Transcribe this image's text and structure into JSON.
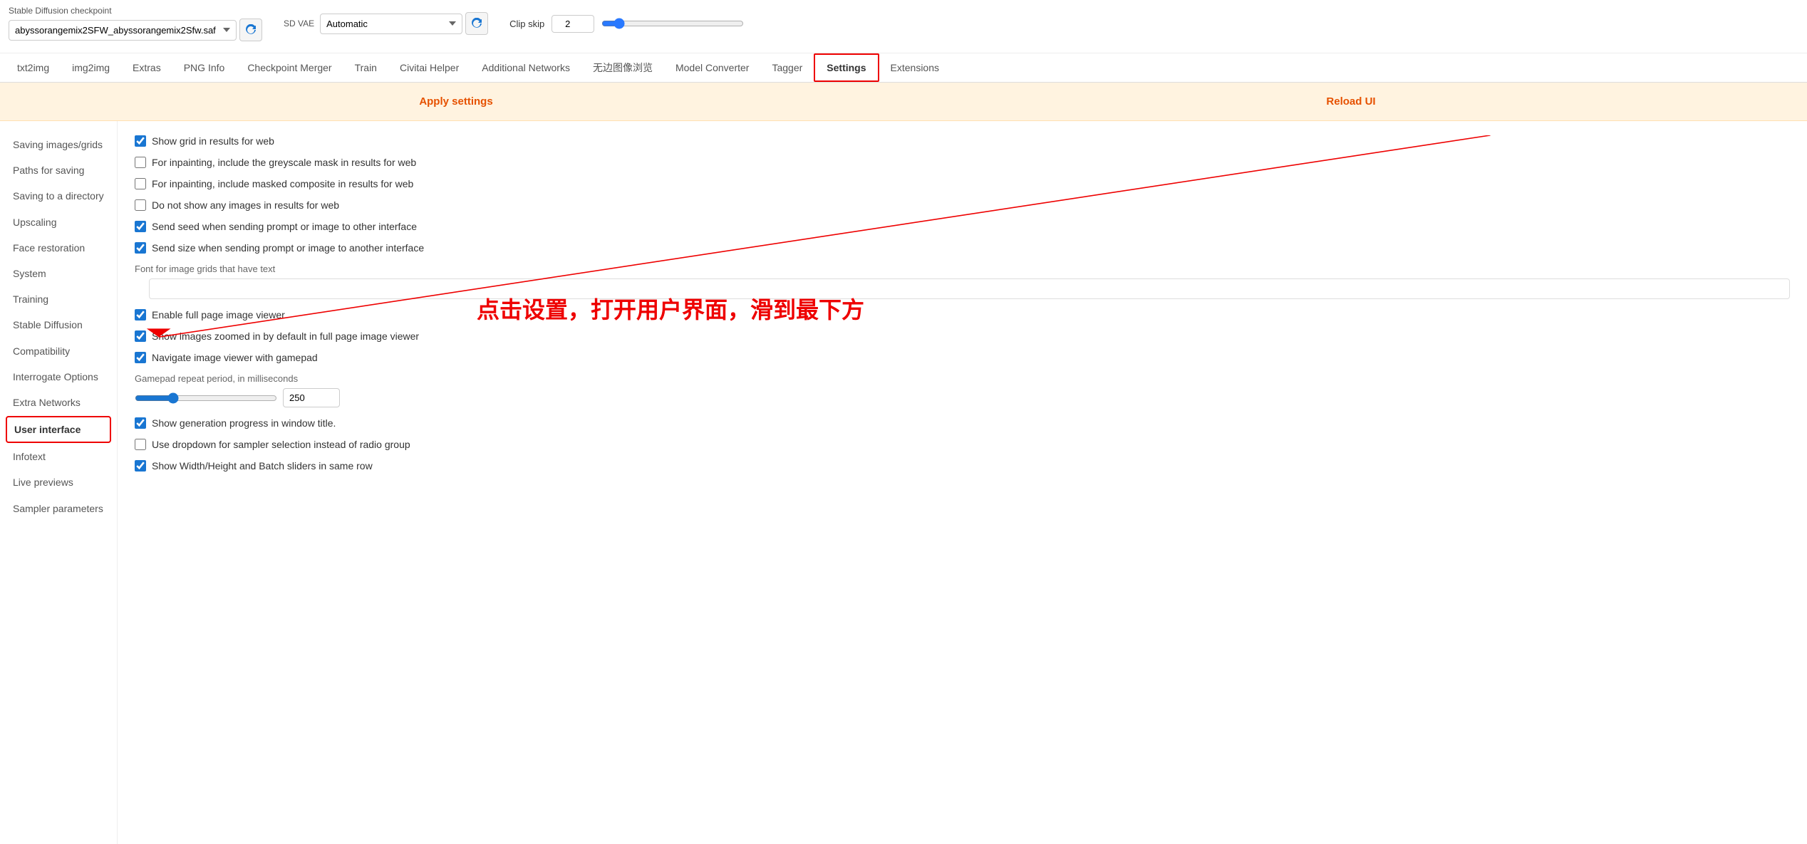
{
  "header": {
    "checkpoint_label": "Stable Diffusion checkpoint",
    "checkpoint_value": "abyssorangemix2SFW_abyssorangemix2Sfw.saf",
    "vae_label": "SD VAE",
    "vae_value": "Automatic",
    "clip_label": "Clip skip",
    "clip_value": "2"
  },
  "nav": {
    "tabs": [
      {
        "id": "txt2img",
        "label": "txt2img"
      },
      {
        "id": "img2img",
        "label": "img2img"
      },
      {
        "id": "extras",
        "label": "Extras"
      },
      {
        "id": "png-info",
        "label": "PNG Info"
      },
      {
        "id": "checkpoint-merger",
        "label": "Checkpoint Merger"
      },
      {
        "id": "train",
        "label": "Train"
      },
      {
        "id": "civitai-helper",
        "label": "Civitai Helper"
      },
      {
        "id": "additional-networks",
        "label": "Additional Networks"
      },
      {
        "id": "wubian",
        "label": "无边图像浏览"
      },
      {
        "id": "model-converter",
        "label": "Model Converter"
      },
      {
        "id": "tagger",
        "label": "Tagger"
      },
      {
        "id": "settings",
        "label": "Settings"
      },
      {
        "id": "extensions",
        "label": "Extensions"
      }
    ],
    "active": "settings"
  },
  "actions": {
    "apply_label": "Apply settings",
    "reload_label": "Reload UI"
  },
  "sidebar": {
    "items": [
      {
        "id": "saving-images",
        "label": "Saving images/grids"
      },
      {
        "id": "paths-for-saving",
        "label": "Paths for saving"
      },
      {
        "id": "saving-to-directory",
        "label": "Saving to a directory"
      },
      {
        "id": "upscaling",
        "label": "Upscaling"
      },
      {
        "id": "face-restoration",
        "label": "Face restoration"
      },
      {
        "id": "system",
        "label": "System"
      },
      {
        "id": "training",
        "label": "Training"
      },
      {
        "id": "stable-diffusion",
        "label": "Stable Diffusion"
      },
      {
        "id": "compatibility",
        "label": "Compatibility"
      },
      {
        "id": "interrogate-options",
        "label": "Interrogate Options"
      },
      {
        "id": "extra-networks",
        "label": "Extra Networks"
      },
      {
        "id": "user-interface",
        "label": "User interface"
      },
      {
        "id": "infotext",
        "label": "Infotext"
      },
      {
        "id": "live-previews",
        "label": "Live previews"
      },
      {
        "id": "sampler-parameters",
        "label": "Sampler parameters"
      }
    ],
    "active": "user-interface"
  },
  "settings": {
    "checkboxes": [
      {
        "id": "show-grid",
        "label": "Show grid in results for web",
        "checked": true
      },
      {
        "id": "inpainting-greyscale",
        "label": "For inpainting, include the greyscale mask in results for web",
        "checked": false
      },
      {
        "id": "inpainting-masked",
        "label": "For inpainting, include masked composite in results for web",
        "checked": false
      },
      {
        "id": "no-show-images",
        "label": "Do not show any images in results for web",
        "checked": false
      },
      {
        "id": "send-seed",
        "label": "Send seed when sending prompt or image to other interface",
        "checked": true
      },
      {
        "id": "send-size",
        "label": "Send size when sending prompt or image to another interface",
        "checked": true
      },
      {
        "id": "enable-full-page",
        "label": "Enable full page image viewer",
        "checked": true
      },
      {
        "id": "show-images-zoomed",
        "label": "Show images zoomed in by default in full page image viewer",
        "checked": true
      },
      {
        "id": "navigate-gamepad",
        "label": "Navigate image viewer with gamepad",
        "checked": true
      },
      {
        "id": "show-generation-progress",
        "label": "Show generation progress in window title.",
        "checked": true
      },
      {
        "id": "use-dropdown-sampler",
        "label": "Use dropdown for sampler selection instead of radio group",
        "checked": false
      },
      {
        "id": "show-width-height",
        "label": "Show Width/Height and Batch sliders in same row",
        "checked": true
      }
    ],
    "font_label": "Font for image grids that have text",
    "font_value": "",
    "gamepad_label": "Gamepad repeat period, in milliseconds",
    "gamepad_value": "250"
  },
  "annotation": {
    "chinese_text": "点击设置，打开用户界面，滑到最下方"
  }
}
